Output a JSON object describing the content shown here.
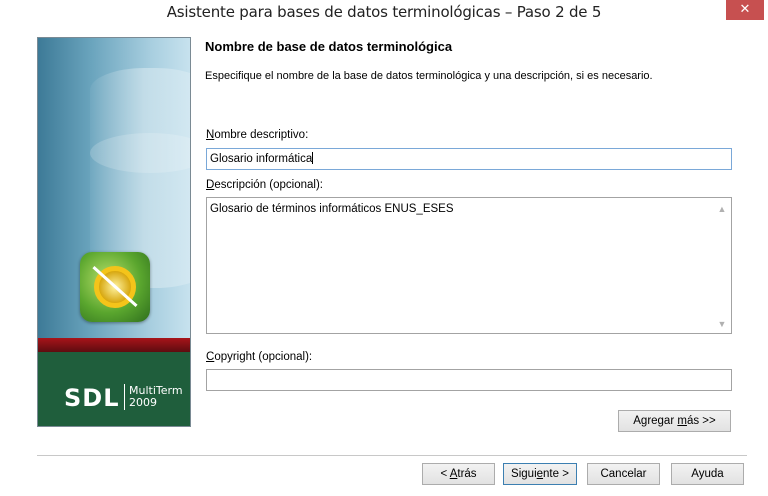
{
  "window": {
    "title": "Asistente para bases de datos terminológicas – Paso 2 de 5",
    "close_label": "✕"
  },
  "banner": {
    "brand": "SDL",
    "product_line1": "MultiTerm",
    "product_line2": "2009"
  },
  "page": {
    "heading": "Nombre de base de datos terminológica",
    "subtitle": "Especifique el nombre de la base de datos terminológica y una descripción, si es necesario."
  },
  "fields": {
    "name": {
      "label_pre": "",
      "label_u": "N",
      "label_post": "ombre descriptivo:",
      "value": "Glosario informática"
    },
    "description": {
      "label_pre": "",
      "label_u": "D",
      "label_post": "escripción (opcional):",
      "value": "Glosario de términos informáticos ENUS_ESES"
    },
    "copyright": {
      "label_pre": "",
      "label_u": "C",
      "label_post": "opyright (opcional):",
      "value": ""
    }
  },
  "buttons": {
    "add_more": {
      "pre": "Agregar ",
      "u": "m",
      "post": "ás >>"
    },
    "back": {
      "pre": "< ",
      "u": "A",
      "post": "trás"
    },
    "next": {
      "pre": "Sigui",
      "u": "e",
      "post": "nte >"
    },
    "cancel": "Cancelar",
    "help": "Ayuda"
  }
}
